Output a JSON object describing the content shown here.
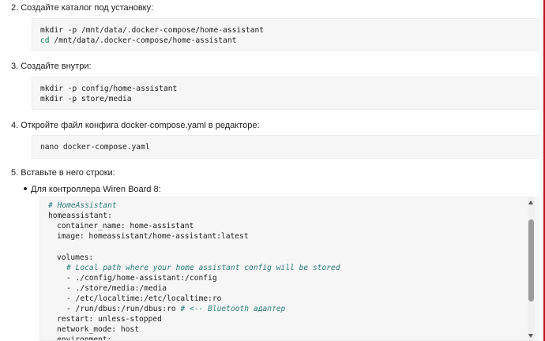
{
  "steps": [
    {
      "label": "2. Создайте каталог под установку:"
    },
    {
      "label": "3. Создайте внутри:"
    },
    {
      "label": "4. Откройте файл конфига docker-compose.yaml в редакторе:"
    },
    {
      "label": "5. Вставьте в него строки:"
    }
  ],
  "code_blocks": {
    "mkdir_catalog": {
      "line1": "mkdir -p /mnt/data/.docker-compose/home-assistant",
      "line2_cmd": "cd",
      "line2_rest": " /mnt/data/.docker-compose/home-assistant"
    },
    "mkdir_inside": {
      "line1": "mkdir -p config/home-assistant",
      "line2": "mkdir -p store/media"
    },
    "nano": {
      "line1": "nano docker-compose.yaml"
    }
  },
  "bullet": "Для контроллера Wiren Board 8:",
  "yaml": {
    "l1": "# HomeAssistant",
    "l2": "homeassistant:",
    "l3": "container_name: home-assistant",
    "l4": "image: homeassistant/home-assistant:latest",
    "l5": "volumes:",
    "l6": "# Local path where your home assistant config will be stored",
    "l7": "- ./config/home-assistant:/config",
    "l8": "- ./store/media:/media",
    "l9": "- /etc/localtime:/etc/localtime:ro",
    "l10": "- /run/dbus:/run/dbus:ro",
    "l10_comment": "# <-- Bluetooth адаптер",
    "l11": "restart: unless-stopped",
    "l12": "network_mode: host",
    "l13": "environment:"
  },
  "colors": {
    "border_accent": "#b8151b",
    "code_bg": "#f6f6f6",
    "comment": "#2d7b7b",
    "keyword_cd": "#0a7a5a"
  }
}
